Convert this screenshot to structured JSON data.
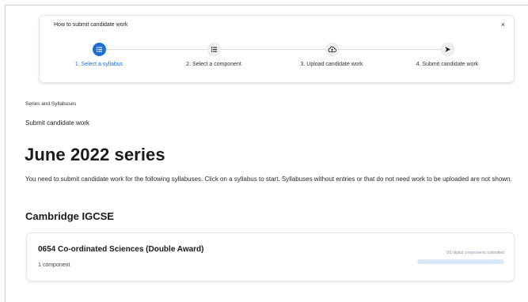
{
  "wizard": {
    "title": "How to submit candidate work",
    "close_glyph": "×",
    "steps": [
      {
        "label": "1. Select a syllabus",
        "icon": "list-icon",
        "active": true
      },
      {
        "label": "2. Select a component",
        "icon": "list-icon",
        "active": false
      },
      {
        "label": "3. Upload candidate work",
        "icon": "cloud-upload-icon",
        "active": false
      },
      {
        "label": "4. Submit candidate work",
        "icon": "send-icon",
        "active": false
      }
    ]
  },
  "breadcrumb": "Series and Syllabuses",
  "subheading": "Submit candidate work",
  "page_title": "June 2022 series",
  "intro": "You need to submit candidate work for the following syllabuses. Click on a syllabus to start. Syllabuses without entries or that do not need work to be uploaded are not shown.",
  "section_title": "Cambridge IGCSE",
  "syllabus_card": {
    "title": "0654 Co-ordinated Sciences (Double Award)",
    "components": "1 component",
    "status": "0/1 digital components submitted",
    "progress_fraction": 0
  },
  "colors": {
    "accent": "#1d6fd8",
    "progress_track": "#dbe8f5"
  }
}
